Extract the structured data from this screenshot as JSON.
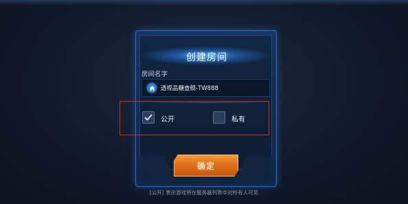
{
  "dialog": {
    "title": "创建房间",
    "room_name_label": "房间名字",
    "room_name_value": "透视品糖查舰-TW888",
    "options": [
      {
        "label": "公开",
        "checked": true
      },
      {
        "label": "私有",
        "checked": false
      }
    ],
    "confirm_label": "确定"
  },
  "footer": {
    "note": "[公开] 表示游戏将在服务器列表中对所有人可见"
  },
  "colors": {
    "accent_blue": "#2f6cc0",
    "confirm_orange": "#e0701a",
    "highlight_red": "#e02424"
  },
  "icons": {
    "room_name": "home-icon",
    "public_checkbox": "checkmark-icon"
  }
}
